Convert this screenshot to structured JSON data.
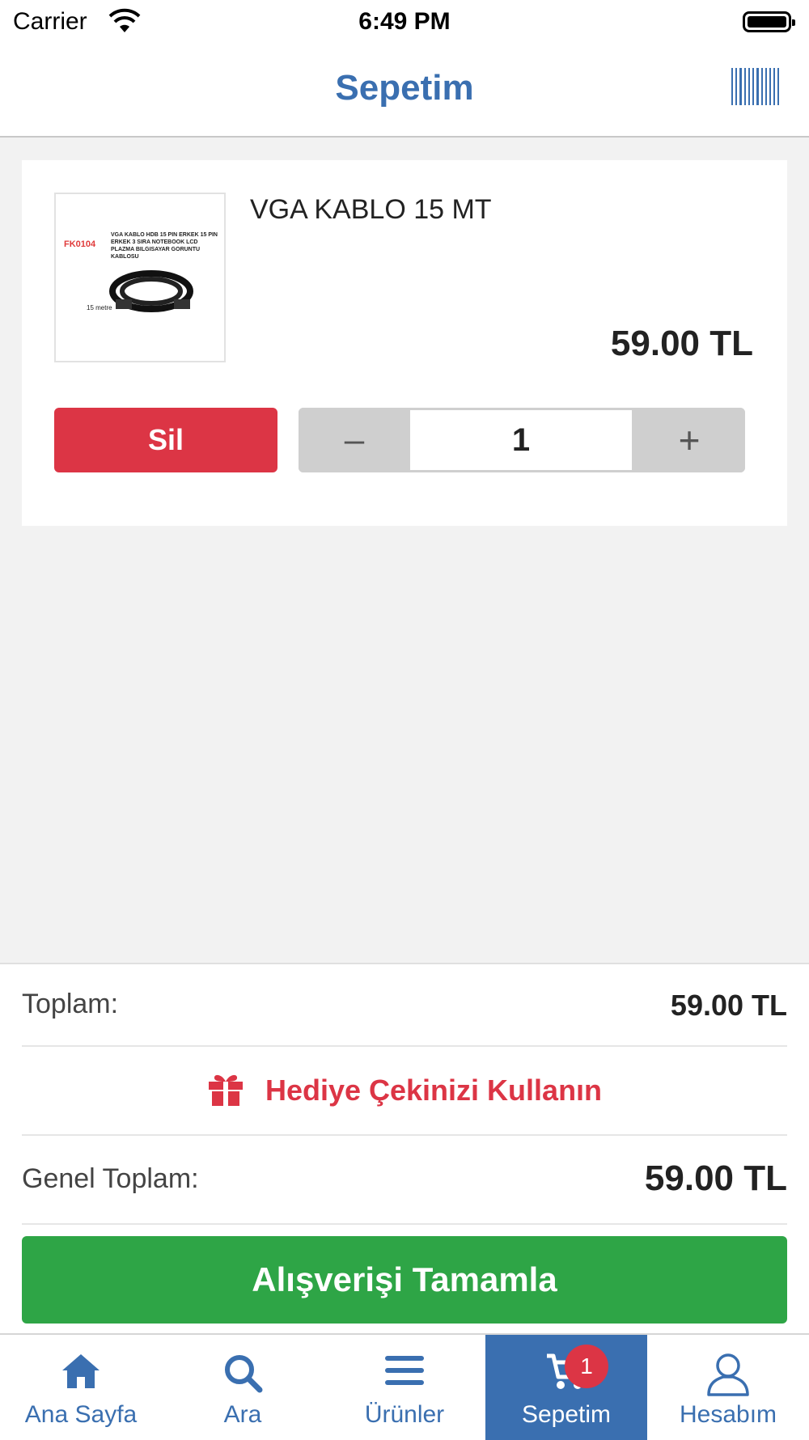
{
  "status_bar": {
    "carrier": "Carrier",
    "time": "6:49 PM"
  },
  "header": {
    "title": "Sepetim"
  },
  "cart": {
    "items": [
      {
        "name": "VGA KABLO 15 MT",
        "price": "59.00 TL",
        "quantity": "1",
        "delete_label": "Sil",
        "minus_label": "–",
        "plus_label": "+",
        "image_code": "FK0104",
        "image_desc": "VGA KABLO HDB 15 PIN ERKEK 15 PIN ERKEK 3 SIRA NOTEBOOK LCD PLAZMA BILGISAYAR GORUNTU KABLOSU",
        "image_meters": "15 metre"
      }
    ]
  },
  "summary": {
    "total_label": "Toplam:",
    "total_value": "59.00 TL",
    "gift_label": "Hediye Çekinizi Kullanın",
    "grand_total_label": "Genel Toplam:",
    "grand_total_value": "59.00 TL",
    "checkout_label": "Alışverişi Tamamla"
  },
  "tab_bar": {
    "tabs": [
      {
        "label": "Ana Sayfa",
        "icon": "home-icon"
      },
      {
        "label": "Ara",
        "icon": "search-icon"
      },
      {
        "label": "Ürünler",
        "icon": "menu-icon"
      },
      {
        "label": "Sepetim",
        "icon": "cart-icon",
        "active": true,
        "badge": "1"
      },
      {
        "label": "Hesabım",
        "icon": "user-icon"
      }
    ]
  },
  "colors": {
    "primary": "#3a6fb0",
    "danger": "#dc3545",
    "success": "#2ea546",
    "background": "#f2f2f2"
  }
}
